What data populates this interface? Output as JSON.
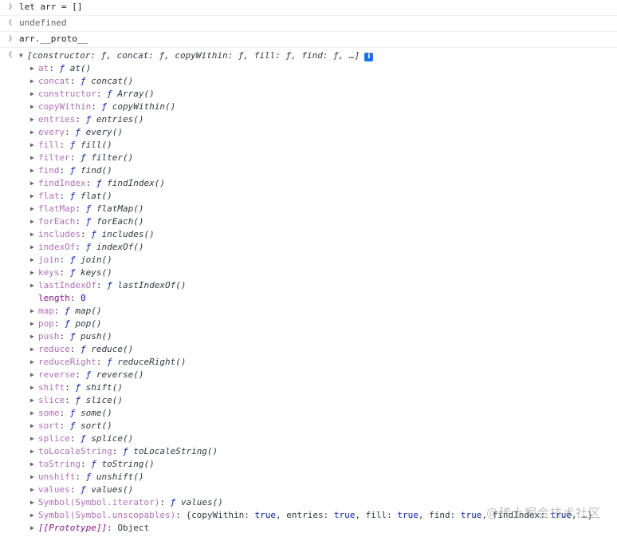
{
  "console": {
    "input1": {
      "prompt": ">",
      "text": "let arr = []"
    },
    "result1": {
      "prompt": "<",
      "text": "undefined"
    },
    "input2": {
      "prompt": ">",
      "text": "arr.__proto__"
    },
    "result2": {
      "prompt": "<",
      "summary": "[constructor: ƒ, concat: ƒ, copyWithin: ƒ, fill: ƒ, find: ƒ, …]",
      "info_icon": "i",
      "properties": [
        {
          "key": "at",
          "f": "ƒ",
          "sig": "at()"
        },
        {
          "key": "concat",
          "f": "ƒ",
          "sig": "concat()"
        },
        {
          "key": "constructor",
          "f": "ƒ",
          "sig": "Array()"
        },
        {
          "key": "copyWithin",
          "f": "ƒ",
          "sig": "copyWithin()"
        },
        {
          "key": "entries",
          "f": "ƒ",
          "sig": "entries()"
        },
        {
          "key": "every",
          "f": "ƒ",
          "sig": "every()"
        },
        {
          "key": "fill",
          "f": "ƒ",
          "sig": "fill()"
        },
        {
          "key": "filter",
          "f": "ƒ",
          "sig": "filter()"
        },
        {
          "key": "find",
          "f": "ƒ",
          "sig": "find()"
        },
        {
          "key": "findIndex",
          "f": "ƒ",
          "sig": "findIndex()"
        },
        {
          "key": "flat",
          "f": "ƒ",
          "sig": "flat()"
        },
        {
          "key": "flatMap",
          "f": "ƒ",
          "sig": "flatMap()"
        },
        {
          "key": "forEach",
          "f": "ƒ",
          "sig": "forEach()"
        },
        {
          "key": "includes",
          "f": "ƒ",
          "sig": "includes()"
        },
        {
          "key": "indexOf",
          "f": "ƒ",
          "sig": "indexOf()"
        },
        {
          "key": "join",
          "f": "ƒ",
          "sig": "join()"
        },
        {
          "key": "keys",
          "f": "ƒ",
          "sig": "keys()"
        },
        {
          "key": "lastIndexOf",
          "f": "ƒ",
          "sig": "lastIndexOf()"
        },
        {
          "key": "length",
          "value": "0"
        },
        {
          "key": "map",
          "f": "ƒ",
          "sig": "map()"
        },
        {
          "key": "pop",
          "f": "ƒ",
          "sig": "pop()"
        },
        {
          "key": "push",
          "f": "ƒ",
          "sig": "push()"
        },
        {
          "key": "reduce",
          "f": "ƒ",
          "sig": "reduce()"
        },
        {
          "key": "reduceRight",
          "f": "ƒ",
          "sig": "reduceRight()"
        },
        {
          "key": "reverse",
          "f": "ƒ",
          "sig": "reverse()"
        },
        {
          "key": "shift",
          "f": "ƒ",
          "sig": "shift()"
        },
        {
          "key": "slice",
          "f": "ƒ",
          "sig": "slice()"
        },
        {
          "key": "some",
          "f": "ƒ",
          "sig": "some()"
        },
        {
          "key": "sort",
          "f": "ƒ",
          "sig": "sort()"
        },
        {
          "key": "splice",
          "f": "ƒ",
          "sig": "splice()"
        },
        {
          "key": "toLocaleString",
          "f": "ƒ",
          "sig": "toLocaleString()"
        },
        {
          "key": "toString",
          "f": "ƒ",
          "sig": "toString()"
        },
        {
          "key": "unshift",
          "f": "ƒ",
          "sig": "unshift()"
        },
        {
          "key": "values",
          "f": "ƒ",
          "sig": "values()"
        },
        {
          "key": "Symbol(Symbol.iterator)",
          "f": "ƒ",
          "sig": "values()"
        }
      ],
      "unscopables": {
        "key": "Symbol(Symbol.unscopables)",
        "entries": [
          {
            "k": "copyWithin",
            "v": "true"
          },
          {
            "k": "entries",
            "v": "true"
          },
          {
            "k": "fill",
            "v": "true"
          },
          {
            "k": "find",
            "v": "true"
          },
          {
            "k": "findIndex",
            "v": "true"
          }
        ],
        "tail": "…}"
      },
      "prototype": {
        "key": "[[Prototype]]",
        "value": "Object"
      }
    }
  },
  "watermark": "@稀土掘金技术社区"
}
